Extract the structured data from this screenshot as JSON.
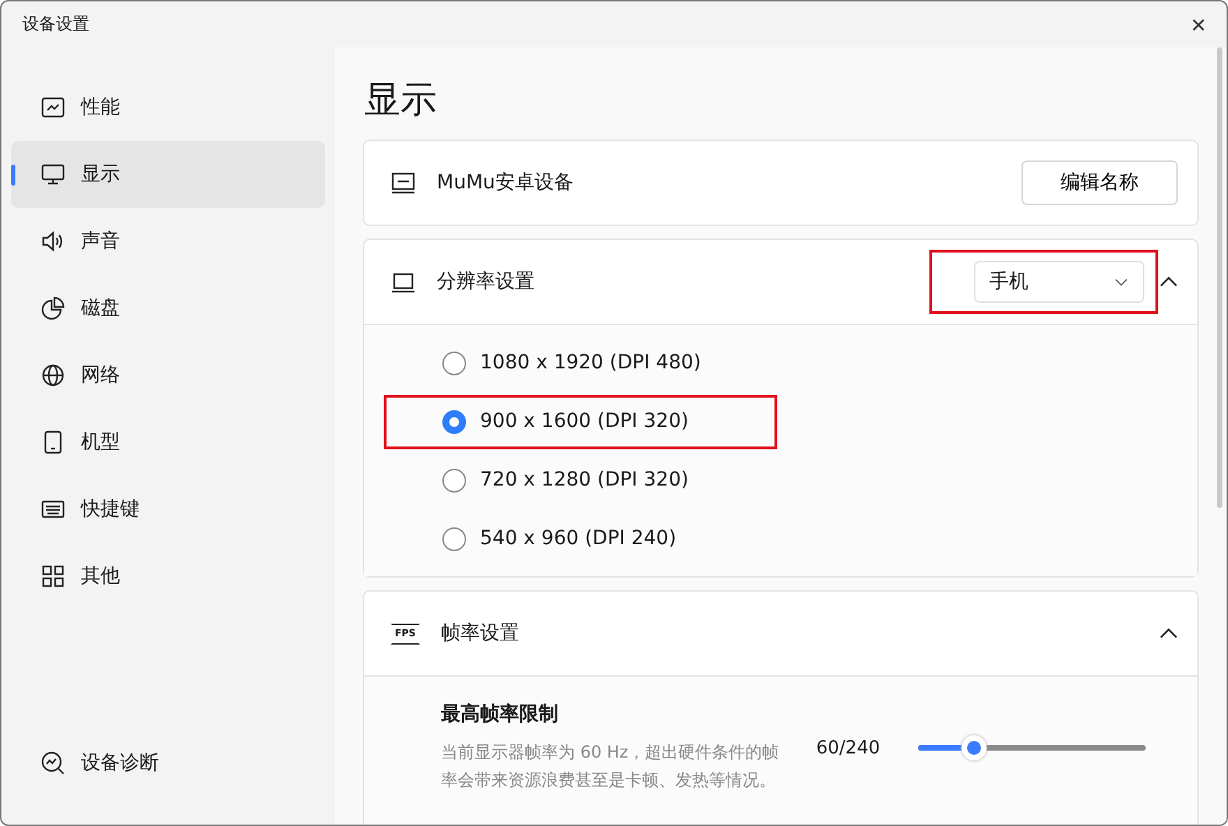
{
  "window": {
    "title": "设备设置",
    "close": "✕"
  },
  "sidebar": {
    "items": [
      {
        "label": "性能",
        "selected": false
      },
      {
        "label": "显示",
        "selected": true
      },
      {
        "label": "声音",
        "selected": false
      },
      {
        "label": "磁盘",
        "selected": false
      },
      {
        "label": "网络",
        "selected": false
      },
      {
        "label": "机型",
        "selected": false
      },
      {
        "label": "快捷键",
        "selected": false
      },
      {
        "label": "其他",
        "selected": false
      }
    ],
    "footer": {
      "label": "设备诊断"
    }
  },
  "page": {
    "title": "显示",
    "device": {
      "name": "MuMu安卓设备",
      "button": "编辑名称"
    },
    "resolution": {
      "title": "分辨率设置",
      "dropdown": {
        "value": "手机",
        "highlighted": true
      },
      "expanded": true,
      "options": [
        {
          "label": "1080 x 1920 (DPI 480)",
          "selected": false,
          "highlighted": false
        },
        {
          "label": "900 x 1600 (DPI 320)",
          "selected": true,
          "highlighted": true
        },
        {
          "label": "720 x 1280 (DPI 320)",
          "selected": false,
          "highlighted": false
        },
        {
          "label": "540 x 960 (DPI 240)",
          "selected": false,
          "highlighted": false
        }
      ]
    },
    "framerate": {
      "title": "帧率设置",
      "icon_text": "FPS",
      "expanded": true,
      "limit": {
        "label": "最高帧率限制",
        "description": "当前显示器帧率为 60 Hz，超出硬件条件的帧率会带来资源浪费甚至是卡顿、发热等情况。",
        "reading": "60/240",
        "level": 0.27
      }
    }
  }
}
